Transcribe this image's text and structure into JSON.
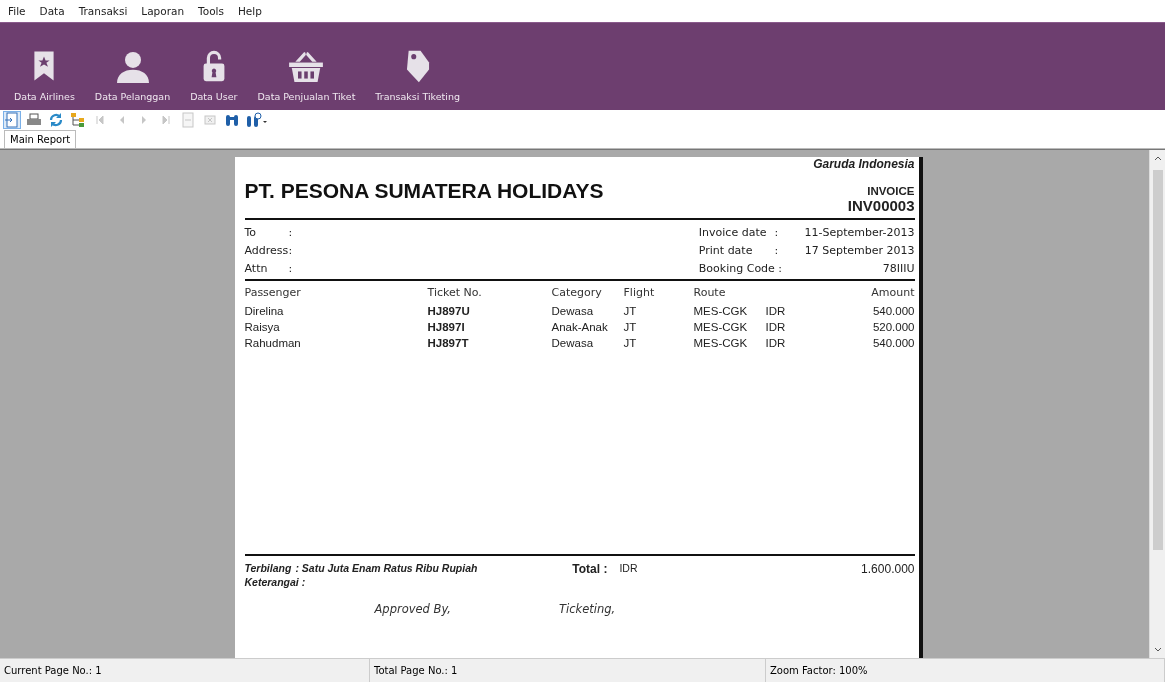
{
  "menu": [
    "File",
    "Data",
    "Transaksi",
    "Laporan",
    "Tools",
    "Help"
  ],
  "ribbon": [
    {
      "kind": "bookmark",
      "label": "Data Airlines"
    },
    {
      "kind": "person",
      "label": "Data Pelanggan"
    },
    {
      "kind": "lock",
      "label": "Data User"
    },
    {
      "kind": "basket",
      "label": "Data Penjualan Tiket"
    },
    {
      "kind": "tag",
      "label": "Transaksi Tiketing"
    }
  ],
  "toolbar": [
    {
      "kind": "export",
      "disabled": false
    },
    {
      "kind": "print",
      "disabled": false
    },
    {
      "kind": "refresh",
      "disabled": false
    },
    {
      "kind": "tree",
      "disabled": false
    },
    {
      "kind": "first",
      "disabled": true
    },
    {
      "kind": "prev",
      "disabled": true
    },
    {
      "kind": "next",
      "disabled": true
    },
    {
      "kind": "last",
      "disabled": true
    },
    {
      "kind": "goto",
      "disabled": true
    },
    {
      "kind": "stop",
      "disabled": true
    },
    {
      "kind": "find",
      "disabled": false
    },
    {
      "kind": "zoom",
      "disabled": false
    }
  ],
  "tabs": [
    {
      "label": "Main Report",
      "selected": true
    }
  ],
  "report": {
    "airline": "Garuda Indonesia",
    "company": "PT. PESONA SUMATERA HOLIDAYS",
    "doc_type": "INVOICE",
    "invoice_no": "INV00003",
    "left_fields": [
      {
        "label": "To",
        "colon": ":"
      },
      {
        "label": "Address",
        "colon": ":"
      },
      {
        "label": "Attn",
        "colon": ":"
      }
    ],
    "right_fields": [
      {
        "label": "Invoice date",
        "colon": ":",
        "value": "11-September-2013"
      },
      {
        "label": "Print date",
        "colon": ":",
        "value": "17 September 2013"
      },
      {
        "label": "Booking Code :",
        "value": "78IIIU"
      }
    ],
    "columns": [
      "Passenger",
      "Ticket No.",
      "Category",
      "Flight",
      "Route",
      "Amount"
    ],
    "rows": [
      {
        "passenger": "Direlina",
        "ticket": "HJ897U",
        "category": "Dewasa",
        "flight": "JT",
        "route": "MES-CGK",
        "currency": "IDR",
        "amount": "540.000"
      },
      {
        "passenger": "Raisya",
        "ticket": "HJ897I",
        "category": "Anak-Anak",
        "flight": "JT",
        "route": "MES-CGK",
        "currency": "IDR",
        "amount": "520.000"
      },
      {
        "passenger": "Rahudman",
        "ticket": "HJ897T",
        "category": "Dewasa",
        "flight": "JT",
        "route": "MES-CGK",
        "currency": "IDR",
        "amount": "540.000"
      }
    ],
    "terbilang_label": "Terbilang",
    "terbilang_value": ": Satu Juta Enam Ratus Ribu  Rupiah",
    "keterangan_label": "Keterangai :",
    "total_label": "Total :",
    "total_currency": "IDR",
    "total_amount": "1.600.000",
    "signatures": [
      "Approved By,",
      "Ticketing,"
    ]
  },
  "status_bar": [
    "Current Page No.: 1",
    "Total Page No.: 1",
    "Zoom Factor: 100%"
  ]
}
